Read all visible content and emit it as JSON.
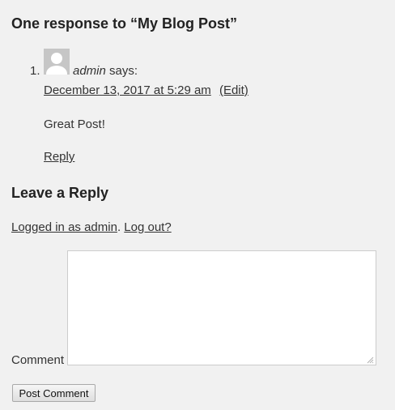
{
  "comments_title": "One response to “My Blog Post”",
  "comment": {
    "number": "1.",
    "author": "admin",
    "says": "says:",
    "date": "December 13, 2017 at 5:29 am",
    "edit_label": "(Edit)",
    "text": "Great Post!",
    "reply_label": "Reply"
  },
  "reply_form": {
    "title": "Leave a Reply",
    "logged_in_label": "Logged in as admin",
    "separator": ".",
    "logout_label": "Log out?",
    "comment_label": "Comment",
    "comment_value": "",
    "submit_label": "Post Comment"
  },
  "icons": {
    "avatar": "default-user-avatar-icon",
    "resize": "resize-grip-icon"
  }
}
